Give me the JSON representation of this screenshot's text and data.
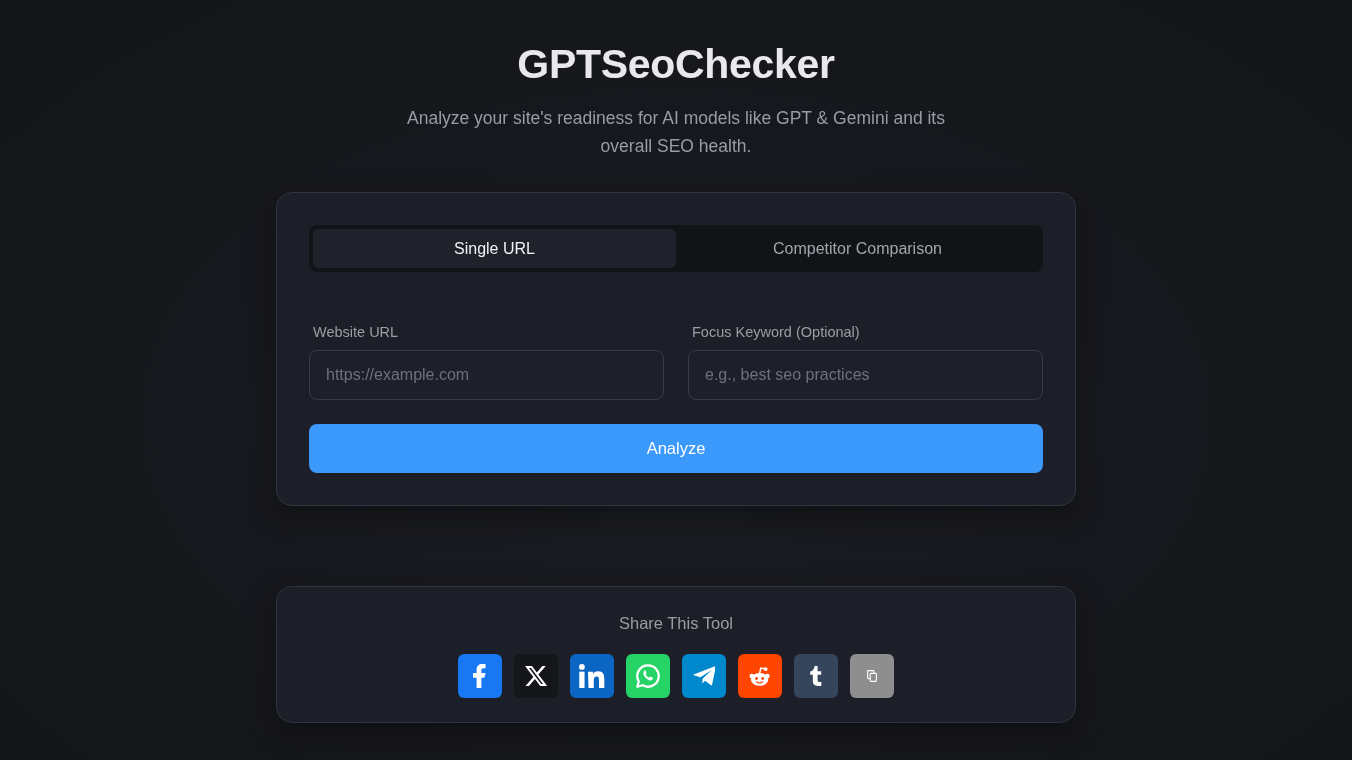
{
  "header": {
    "title": "GPTSeoChecker",
    "subtitle": "Analyze your site's readiness for AI models like GPT & Gemini and its overall SEO health."
  },
  "tabs": [
    {
      "label": "Single URL",
      "selected": true
    },
    {
      "label": "Competitor Comparison",
      "selected": false
    }
  ],
  "fields": [
    {
      "label": "Website URL",
      "placeholder": "https://example.com"
    },
    {
      "label": "Focus Keyword (Optional)",
      "placeholder": "e.g., best seo practices"
    }
  ],
  "submit_button": {
    "label": "Analyze"
  },
  "share": {
    "title": "Share This Tool",
    "buttons": [
      {
        "kind": "facebook",
        "color": "#1877f2"
      },
      {
        "kind": "x",
        "color": "#14161a"
      },
      {
        "kind": "linkedin",
        "color": "#0a66c2"
      },
      {
        "kind": "whatsapp",
        "color": "#25d366"
      },
      {
        "kind": "telegram",
        "color": "#0088cc"
      },
      {
        "kind": "reddit",
        "color": "#ff4500"
      },
      {
        "kind": "tumblr",
        "color": "#35465c"
      },
      {
        "kind": "copy",
        "color": "#8e8e8e"
      }
    ]
  }
}
